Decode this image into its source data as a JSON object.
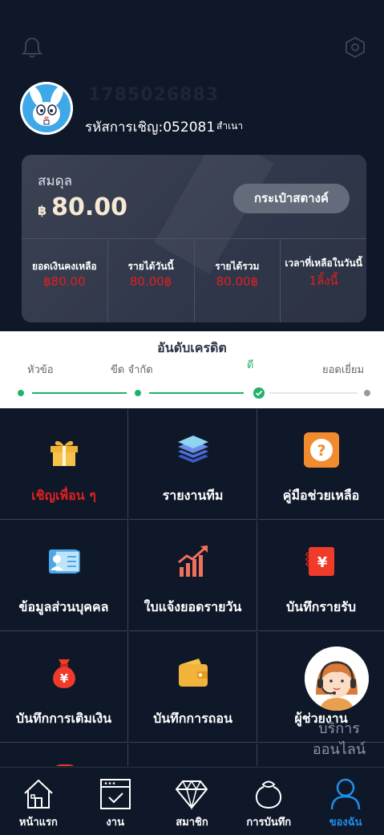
{
  "header": {
    "bell_icon": "bell-icon",
    "settings_icon": "hexagon-settings-icon"
  },
  "profile": {
    "username": "1785026883",
    "invite_label": "รหัสการเชิญ:052081",
    "copy_label": "สำเนา"
  },
  "balance": {
    "label": "สมดุล",
    "currency": "฿",
    "amount": "80.00",
    "wallet_button": "กระเป๋าสตางค์"
  },
  "stats": [
    {
      "label": "ยอดเงินคงเหลือ",
      "value": "฿80.00"
    },
    {
      "label": "รายได้วันนี้",
      "value": "80.00฿"
    },
    {
      "label": "รายได้รวม",
      "value": "80.00฿"
    },
    {
      "label": "เวลาที่เหลือในวันนี้",
      "value": "1ลิ้งนี้"
    }
  ],
  "credit": {
    "title": "อันดับเครดิต",
    "levels": [
      "หัวข้อ",
      "ขีด จำกัด",
      "ดี",
      "ยอดเยี่ยม"
    ],
    "active_level": 2
  },
  "menu": [
    {
      "label": "เชิญเพื่อน ๆ",
      "icon": "gift-icon",
      "highlight": true
    },
    {
      "label": "รายงานทีม",
      "icon": "layers-icon"
    },
    {
      "label": "คู่มือช่วยเหลือ",
      "icon": "help-icon"
    },
    {
      "label": "ข้อมูลส่วนบุคคล",
      "icon": "id-card-icon"
    },
    {
      "label": "ใบแจ้งยอดรายวัน",
      "icon": "growth-chart-icon"
    },
    {
      "label": "บันทึกรายรับ",
      "icon": "yen-receipt-icon"
    },
    {
      "label": "บันทึกการเติมเงิน",
      "icon": "money-bag-icon"
    },
    {
      "label": "บันทึกการถอน",
      "icon": "wallet-icon"
    },
    {
      "label": "ผู้ช่วยงาน",
      "icon": "assistant-icon"
    }
  ],
  "support": {
    "text_line1": "บริการ",
    "text_line2": "ออนไลน์"
  },
  "tabbar": [
    {
      "label": "หน้าแรก",
      "icon": "home-icon"
    },
    {
      "label": "งาน",
      "icon": "task-icon"
    },
    {
      "label": "สมาชิก",
      "icon": "diamond-icon"
    },
    {
      "label": "การบันทึก",
      "icon": "bag-icon"
    },
    {
      "label": "ของฉัน",
      "icon": "user-icon",
      "active": true
    }
  ],
  "colors": {
    "background": "#0f1829",
    "accent_red": "#e02020",
    "active_blue": "#1e8ee8",
    "credit_green": "#1fb36a"
  }
}
